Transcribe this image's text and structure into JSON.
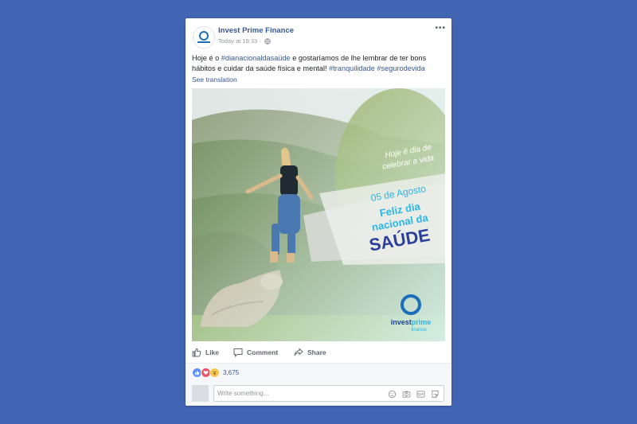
{
  "post": {
    "page_name": "Invest Prime Finance",
    "timestamp": "Today at 19:33",
    "meta_sep": "·",
    "more_label": "•••",
    "text_prefix": "Hoje é o ",
    "hashtag_1": "#dianacionaldasaúde",
    "text_middle": " e gostaríamos de lhe lembrar de ter bons hábitos e cuidar da saúde física e mental! ",
    "hashtag_2": "#tranquilidade",
    "hashtag_3": "#segurodevida",
    "see_translation": "See translation"
  },
  "image": {
    "tagline_line1": "Hoje é dia de",
    "tagline_line2": "celebrar a vida",
    "date": "05 de Agosto",
    "headline_line1": "Feliz dia",
    "headline_line2": "nacional da",
    "headline_big": "SAÚDE",
    "logo_word_1": "invest",
    "logo_word_2": "prime",
    "logo_sub": "finance"
  },
  "actions": {
    "like": "Like",
    "comment": "Comment",
    "share": "Share"
  },
  "reactions": {
    "count": "3,675",
    "types": [
      "like-icon",
      "love-icon",
      "wow-icon"
    ]
  },
  "comment_box": {
    "placeholder": "Write something..."
  },
  "colors": {
    "background": "#4265b3",
    "link": "#365899",
    "brand_blue": "#1b6fb8",
    "headline_cyan": "#2bb6e6",
    "headline_navy": "#2b3f9b"
  }
}
